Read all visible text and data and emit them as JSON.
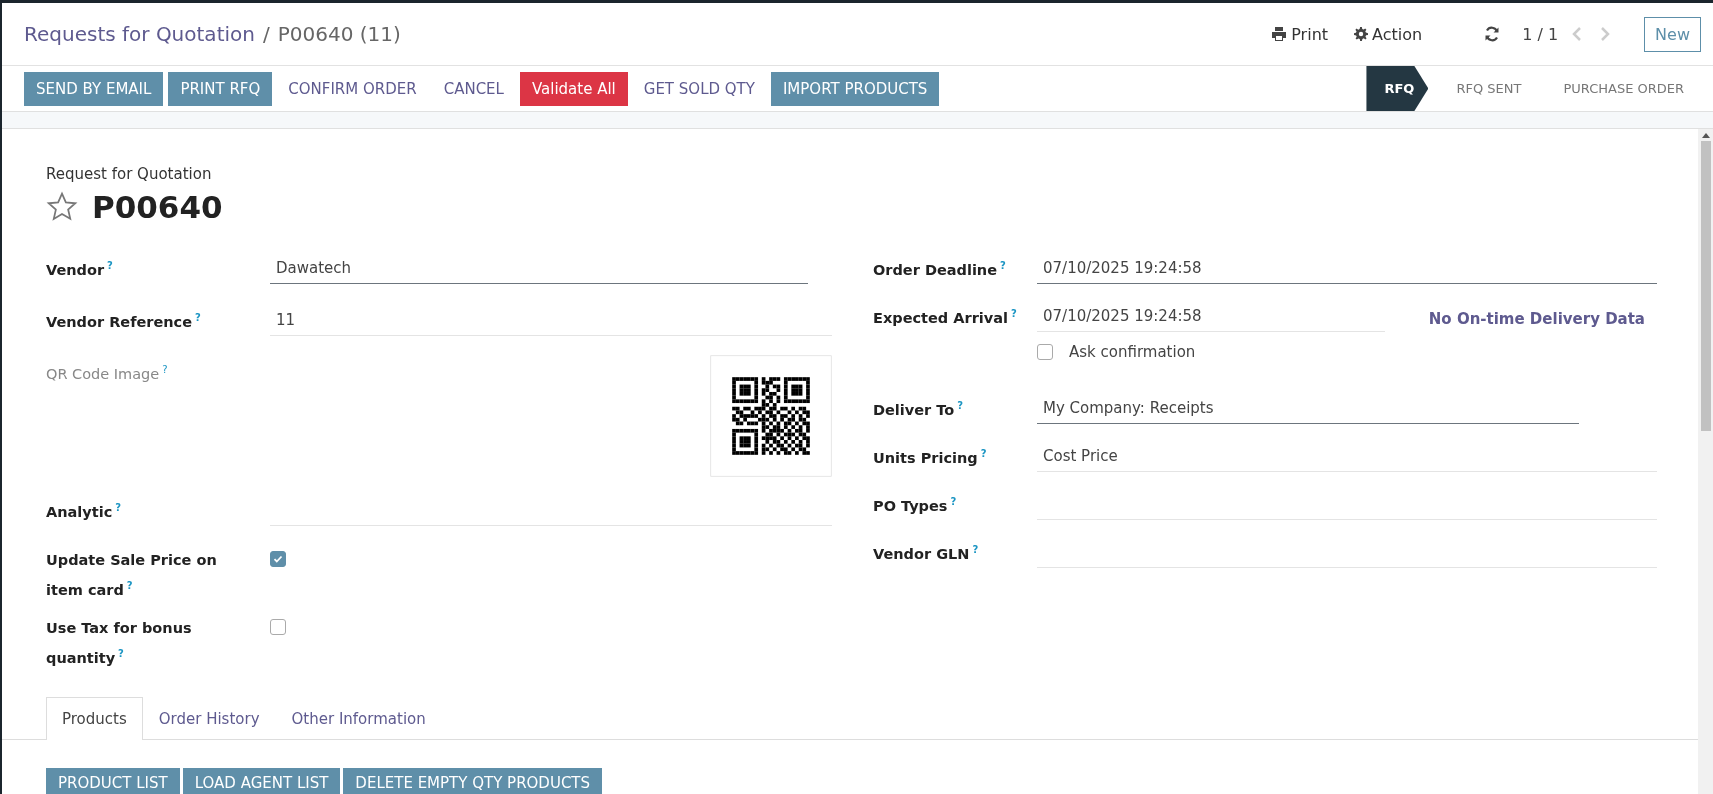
{
  "breadcrumb": {
    "parent": "Requests for Quotation",
    "separator": "/",
    "current": "P00640 (11)"
  },
  "header_actions": {
    "print": "Print",
    "action": "Action",
    "pager": "1 / 1",
    "new": "New"
  },
  "action_buttons": [
    {
      "label": "SEND BY EMAIL",
      "kind": "primary"
    },
    {
      "label": "PRINT RFQ",
      "kind": "primary"
    },
    {
      "label": "CONFIRM ORDER",
      "kind": "link"
    },
    {
      "label": "CANCEL",
      "kind": "link"
    },
    {
      "label": "Validate All",
      "kind": "danger"
    },
    {
      "label": "GET SOLD QTY",
      "kind": "link"
    },
    {
      "label": "IMPORT PRODUCTS",
      "kind": "primary"
    }
  ],
  "statusbar": [
    {
      "label": "RFQ",
      "selected": true
    },
    {
      "label": "RFQ SENT",
      "selected": false
    },
    {
      "label": "PURCHASE ORDER",
      "selected": false
    }
  ],
  "form": {
    "subtitle": "Request for Quotation",
    "name": "P00640",
    "starred": false,
    "left_fields": [
      {
        "label": "Vendor",
        "help": "?",
        "kind": "input",
        "value": "Dawatech"
      },
      {
        "label": "Vendor Reference",
        "help": "?",
        "kind": "readonly",
        "value": "11"
      },
      {
        "label": "QR Code Image",
        "help": "?",
        "kind": "image"
      },
      {
        "label": "Analytic",
        "help": "?",
        "kind": "readonly"
      },
      {
        "label": "Update Sale Price on item card",
        "help": "?",
        "kind": "checkbox",
        "checked": true
      },
      {
        "label": "Use Tax for bonus quantity",
        "help": "?",
        "kind": "checkbox",
        "checked": false
      }
    ],
    "right_fields": [
      {
        "label": "Order Deadline",
        "help": "?",
        "kind": "input",
        "value": "07/10/2025 19:24:58"
      },
      {
        "label": "Expected Arrival",
        "help": "?",
        "kind": "readonly",
        "value": "07/10/2025 19:24:58",
        "link": "No On-time Delivery Data",
        "confirmation": {
          "label": "Ask confirmation",
          "checked": false
        }
      },
      {
        "label": "Deliver To",
        "help": "?",
        "kind": "input",
        "value": "My Company: Receipts"
      },
      {
        "label": "Units Pricing",
        "help": "?",
        "kind": "readonly",
        "value": "Cost Price"
      },
      {
        "label": "PO Types",
        "help": "?",
        "kind": "readonly"
      },
      {
        "label": "Vendor GLN",
        "help": "?",
        "kind": "readonly"
      }
    ]
  },
  "tabs": [
    {
      "label": "Products",
      "selected": true
    },
    {
      "label": "Order History",
      "selected": false
    },
    {
      "label": "Other Information",
      "selected": false
    }
  ],
  "product_buttons": [
    "PRODUCT LIST",
    "LOAD AGENT LIST",
    "DELETE EMPTY QTY PRODUCTS"
  ]
}
